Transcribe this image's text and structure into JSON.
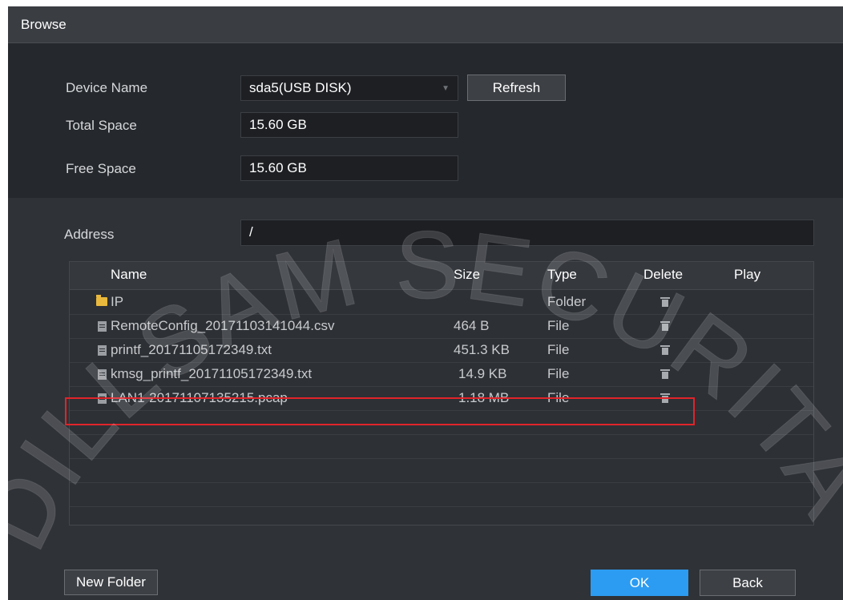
{
  "window": {
    "title": "Browse"
  },
  "device": {
    "name_label": "Device Name",
    "name_value": "sda5(USB DISK)",
    "refresh_label": "Refresh",
    "total_label": "Total Space",
    "total_value": "15.60 GB",
    "free_label": "Free Space",
    "free_value": "15.60 GB"
  },
  "address": {
    "label": "Address",
    "value": "/"
  },
  "table": {
    "columns": [
      "Name",
      "Size",
      "Type",
      "Delete",
      "Play"
    ],
    "rows": [
      {
        "name": "IP",
        "size": "",
        "type": "Folder",
        "icon": "folder-icon"
      },
      {
        "name": "RemoteConfig_20171103141044.csv",
        "size": "464 B",
        "type": "File",
        "icon": "file-icon"
      },
      {
        "name": "printf_20171105172349.txt",
        "size": "451.3 KB",
        "type": "File",
        "icon": "file-icon"
      },
      {
        "name": "kmsg_printf_20171105172349.txt",
        "size": "14.9 KB",
        "type": "File",
        "icon": "file-icon"
      },
      {
        "name": "LAN1-20171107135215.pcap",
        "size": "1.18 MB",
        "type": "File",
        "icon": "file-icon",
        "highlighted": true
      }
    ]
  },
  "footer": {
    "new_folder_label": "New Folder",
    "ok_label": "OK",
    "back_label": "Back"
  },
  "colors": {
    "accent": "#2c9cf2",
    "highlight": "#e0242a",
    "folder": "#e9b93d"
  },
  "watermark": {
    "text": "DILLSAM SECURITA"
  }
}
